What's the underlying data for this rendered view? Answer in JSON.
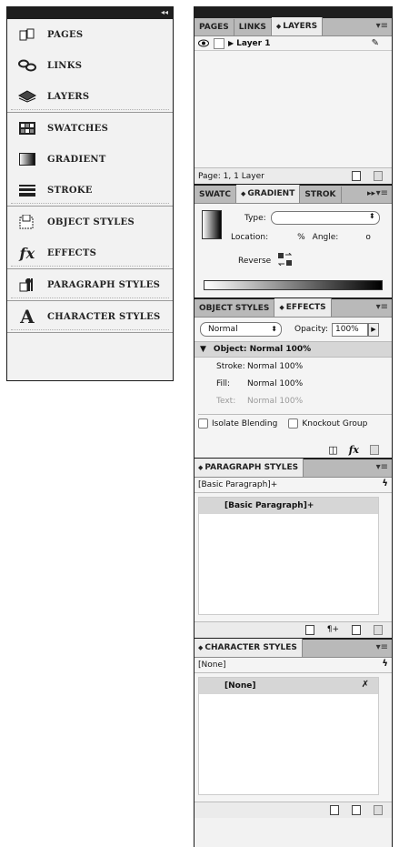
{
  "left_panel": {
    "collapse_glyph": "◂◂",
    "groups": [
      [
        {
          "label": "PAGES",
          "icon": "pages-icon"
        },
        {
          "label": "LINKS",
          "icon": "links-icon"
        },
        {
          "label": "LAYERS",
          "icon": "layers-icon"
        }
      ],
      [
        {
          "label": "SWATCHES",
          "icon": "swatches-icon"
        },
        {
          "label": "GRADIENT",
          "icon": "gradient-icon"
        },
        {
          "label": "STROKE",
          "icon": "stroke-icon"
        }
      ],
      [
        {
          "label": "OBJECT STYLES",
          "icon": "object-styles-icon"
        },
        {
          "label": "EFFECTS",
          "icon": "fx-icon"
        }
      ],
      [
        {
          "label": "PARAGRAPH STYLES",
          "icon": "paragraph-styles-icon"
        }
      ],
      [
        {
          "label": "CHARACTER STYLES",
          "icon": "character-styles-icon"
        }
      ]
    ]
  },
  "layers_panel": {
    "tabs": [
      "PAGES",
      "LINKS",
      "LAYERS"
    ],
    "active_tab": "LAYERS",
    "layer_name": "Layer 1",
    "footer_status": "Page: 1, 1 Layer"
  },
  "gradient_panel": {
    "tabs": [
      "SWATC",
      "GRADIENT",
      "STROK"
    ],
    "active_tab": "GRADIENT",
    "type_label": "Type:",
    "location_label": "Location:",
    "percent_label": "%",
    "angle_label": "Angle:",
    "angle_unit": "o",
    "reverse_label": "Reverse"
  },
  "effects_panel": {
    "tabs": [
      "OBJECT STYLES",
      "EFFECTS"
    ],
    "active_tab": "EFFECTS",
    "blend_mode": "Normal",
    "opacity_label": "Opacity:",
    "opacity_value": "100%",
    "object_row": "Object: Normal 100%",
    "rows": [
      {
        "label": "Stroke:",
        "value": "Normal 100%"
      },
      {
        "label": "Fill:",
        "value": "Normal 100%"
      },
      {
        "label": "Text:",
        "value": "Normal 100%"
      }
    ],
    "isolate_label": "Isolate Blending",
    "knockout_label": "Knockout Group",
    "fx_label": "fx"
  },
  "paragraph_panel": {
    "tab": "PARAGRAPH STYLES",
    "current": "[Basic Paragraph]+",
    "selected": "[Basic Paragraph]+"
  },
  "character_panel": {
    "tab": "CHARACTER STYLES",
    "current": "[None]",
    "selected": "[None]"
  },
  "colors": {
    "chrome_dark": "#1e1e1e",
    "tab_bg": "#b9b9b9",
    "selected_row": "#d6d6d6"
  }
}
